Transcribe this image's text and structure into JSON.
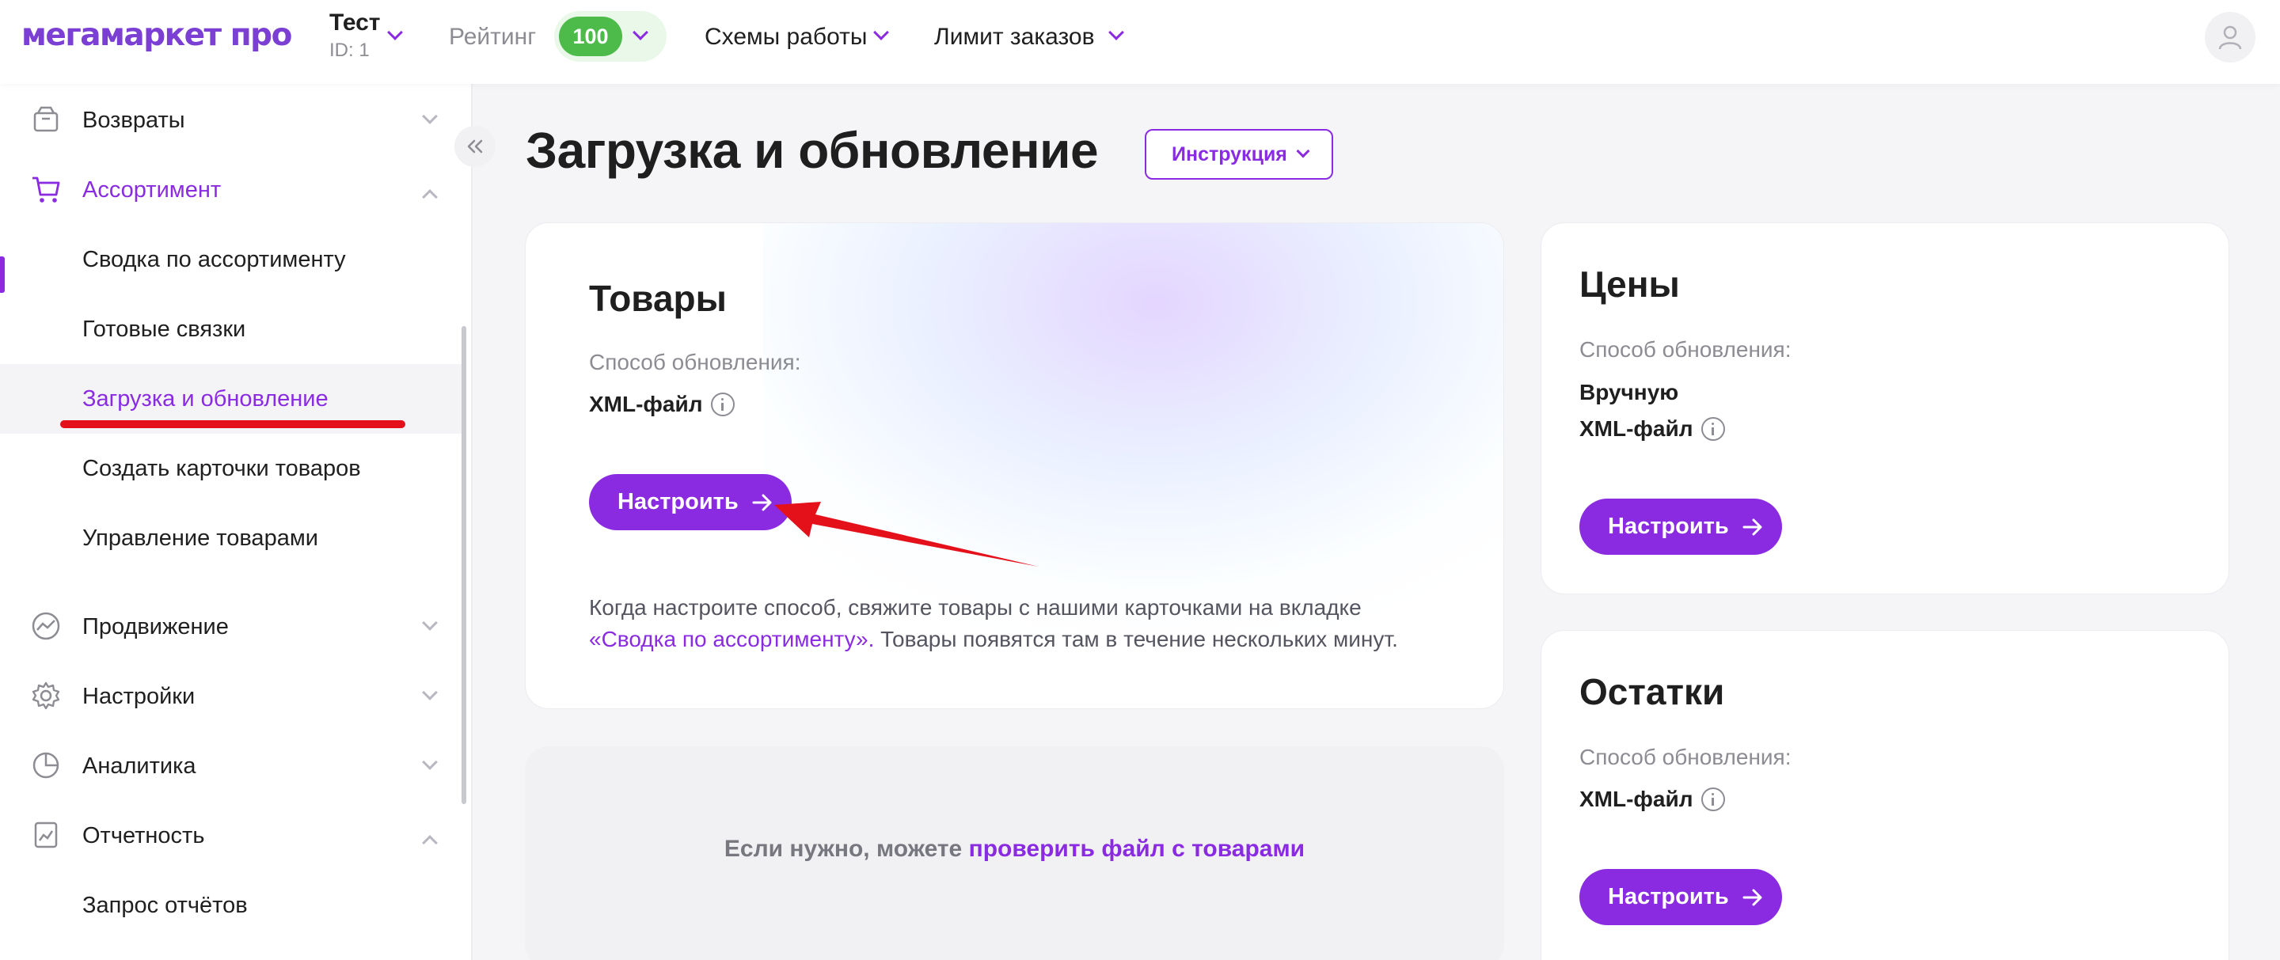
{
  "header": {
    "logo": "мегамаркет про",
    "account_name": "Тест",
    "account_id": "ID: 1",
    "rating_label": "Рейтинг",
    "rating_value": "100",
    "nav": [
      "Схемы работы",
      "Лимит заказов"
    ]
  },
  "sidebar": {
    "items": [
      {
        "label": "Возвраты",
        "icon": "box-icon",
        "state": "collapsed"
      },
      {
        "label": "Ассортимент",
        "icon": "cart-icon",
        "state": "expanded",
        "active": true
      },
      {
        "label": "Продвижение",
        "icon": "trend-icon",
        "state": "collapsed"
      },
      {
        "label": "Настройки",
        "icon": "gear-icon",
        "state": "collapsed"
      },
      {
        "label": "Аналитика",
        "icon": "pie-chart-icon",
        "state": "collapsed"
      },
      {
        "label": "Отчетность",
        "icon": "report-icon",
        "state": "expanded"
      }
    ],
    "assortment_sub": [
      "Сводка по ассортименту",
      "Готовые связки",
      "Загрузка и обновление",
      "Создать карточки товаров",
      "Управление товарами"
    ],
    "reports_sub": [
      "Запрос отчётов"
    ]
  },
  "main": {
    "title": "Загрузка и обновление",
    "instruction_button": "Инструкция",
    "goods": {
      "title": "Товары",
      "method_label": "Способ обновления:",
      "method": "XML-файл",
      "button": "Настроить",
      "note_1": "Когда настроите способ, свяжите товары с нашими карточками на вкладке",
      "note_link": "«Сводка по ассортименту».",
      "note_2": " Товары появятся там в течение нескольких минут."
    },
    "check": {
      "text": "Если нужно, можете ",
      "link": "проверить файл с товарами"
    },
    "prices": {
      "title": "Цены",
      "method_label": "Способ обновления:",
      "method_1": "Вручную",
      "method_2": "XML-файл",
      "button": "Настроить"
    },
    "stock": {
      "title": "Остатки",
      "method_label": "Способ обновления:",
      "method": "XML-файл",
      "button": "Настроить"
    }
  },
  "colors": {
    "accent": "#8a2be2",
    "rating": "#4cbb4a",
    "annotation": "#e4111b"
  }
}
